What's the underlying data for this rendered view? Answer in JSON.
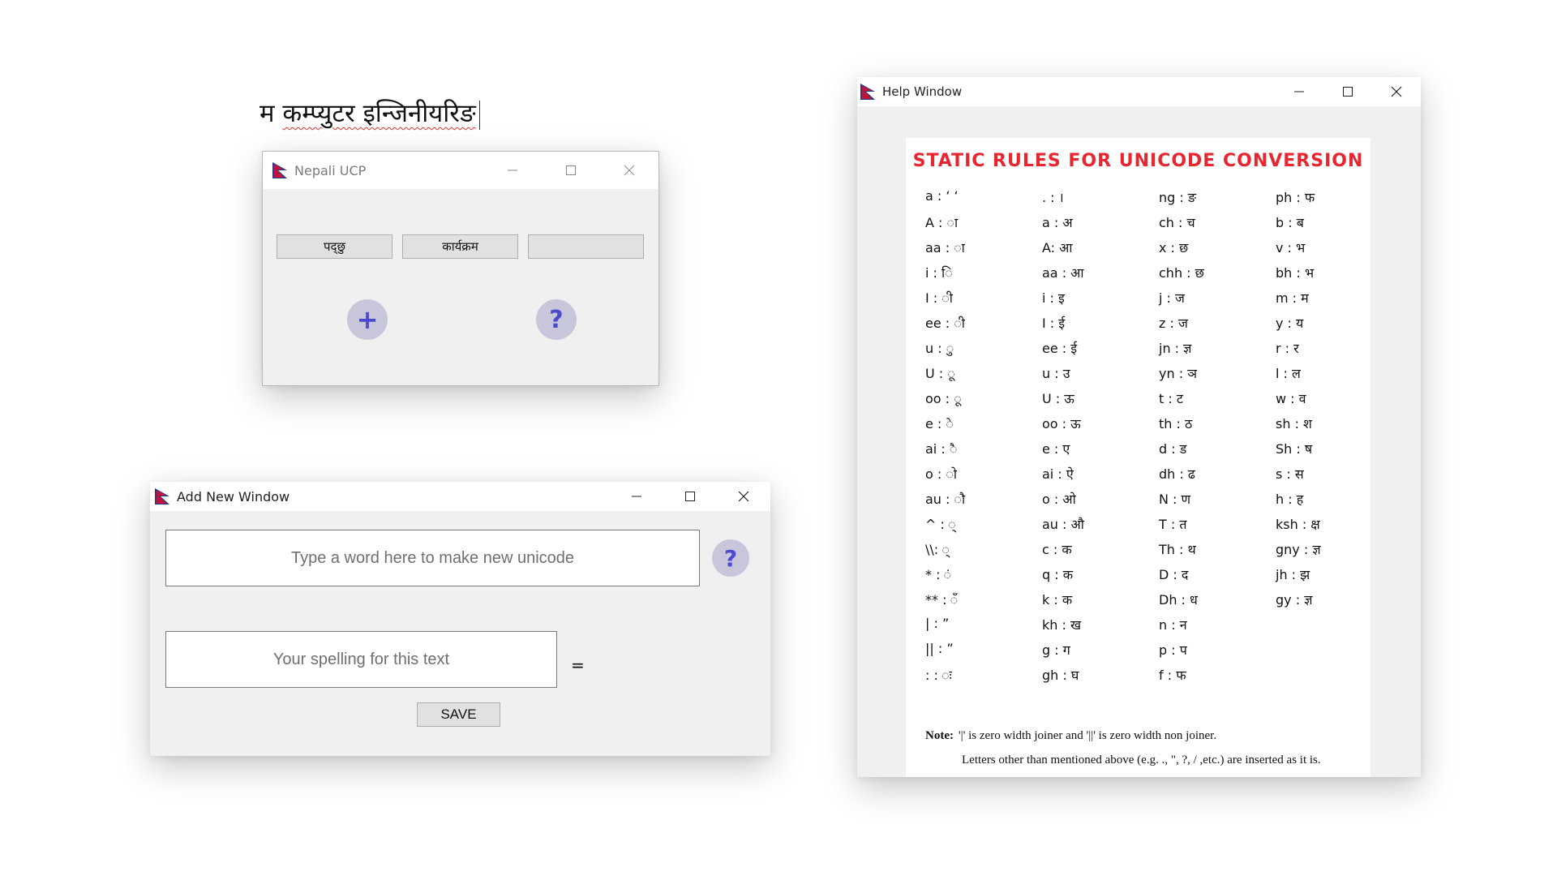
{
  "typed_text": {
    "part1": "म ",
    "part2": "कम्प्युटर इन्जिनीयरिङ"
  },
  "ucp_window": {
    "title": "Nepali UCP",
    "buttons": [
      "पद्छु",
      "कार्यक्रम",
      ""
    ],
    "add_symbol": "+",
    "help_symbol": "?"
  },
  "add_window": {
    "title": "Add New Window",
    "word_input_placeholder": "Type a word here to make new unicode",
    "spelling_input_placeholder": "Your spelling for this text",
    "equals": "=",
    "help_symbol": "?",
    "save_label": "SAVE"
  },
  "help_window": {
    "title": "Help Window",
    "heading": "STATIC RULES FOR UNICODE CONVERSION",
    "columns": [
      [
        "a : ‘ ‘",
        "A : ा",
        "aa : ा",
        "i : ि",
        "I : ी",
        "ee : ी",
        "u : ु",
        "U : ू",
        "oo : ू",
        "e : े",
        "ai : ै",
        "o : ो",
        "au : ौ",
        "^ : ्",
        "\\\\: ्",
        "* : ं",
        "** : ँ",
        "| : ”",
        "|| : ”",
        ": : ः"
      ],
      [
        ". : ।",
        "a : अ",
        "A: आ",
        "aa : आ",
        "i : इ",
        "I : ई",
        "ee : ई",
        "u : उ",
        "U : ऊ",
        "oo : ऊ",
        "e : ए",
        "ai : ऐ",
        "o : ओ",
        "au : औ",
        "c : क",
        "q : क",
        "k : क",
        "kh : ख",
        "g : ग",
        "gh : घ"
      ],
      [
        "ng : ङ",
        "ch : च",
        "x : छ",
        "chh : छ",
        "j : ज",
        "z : ज",
        "jn : ज्ञ",
        "yn : ञ",
        "t : ट",
        "th : ठ",
        "d : ड",
        "dh : ढ",
        "N : ण",
        "T : त",
        "Th : थ",
        "D : द",
        "Dh : ध",
        "n : न",
        "p : प",
        "f : फ"
      ],
      [
        "ph : फ",
        "b : ब",
        "v : भ",
        "bh : भ",
        "m : म",
        "y : य",
        "r : र",
        "l : ल",
        "w : व",
        "sh : श",
        "Sh : ष",
        "s : स",
        "h : ह",
        "ksh : क्ष",
        "gny : ज्ञ",
        "jh : झ",
        "gy : ज्ञ"
      ]
    ],
    "note_label": "Note:",
    "note_line1": "'|' is zero width joiner and '||' is zero width non joiner.",
    "note_line2": "Letters other than mentioned above (e.g. ., \", ?, / ,etc.) are inserted as it is."
  }
}
